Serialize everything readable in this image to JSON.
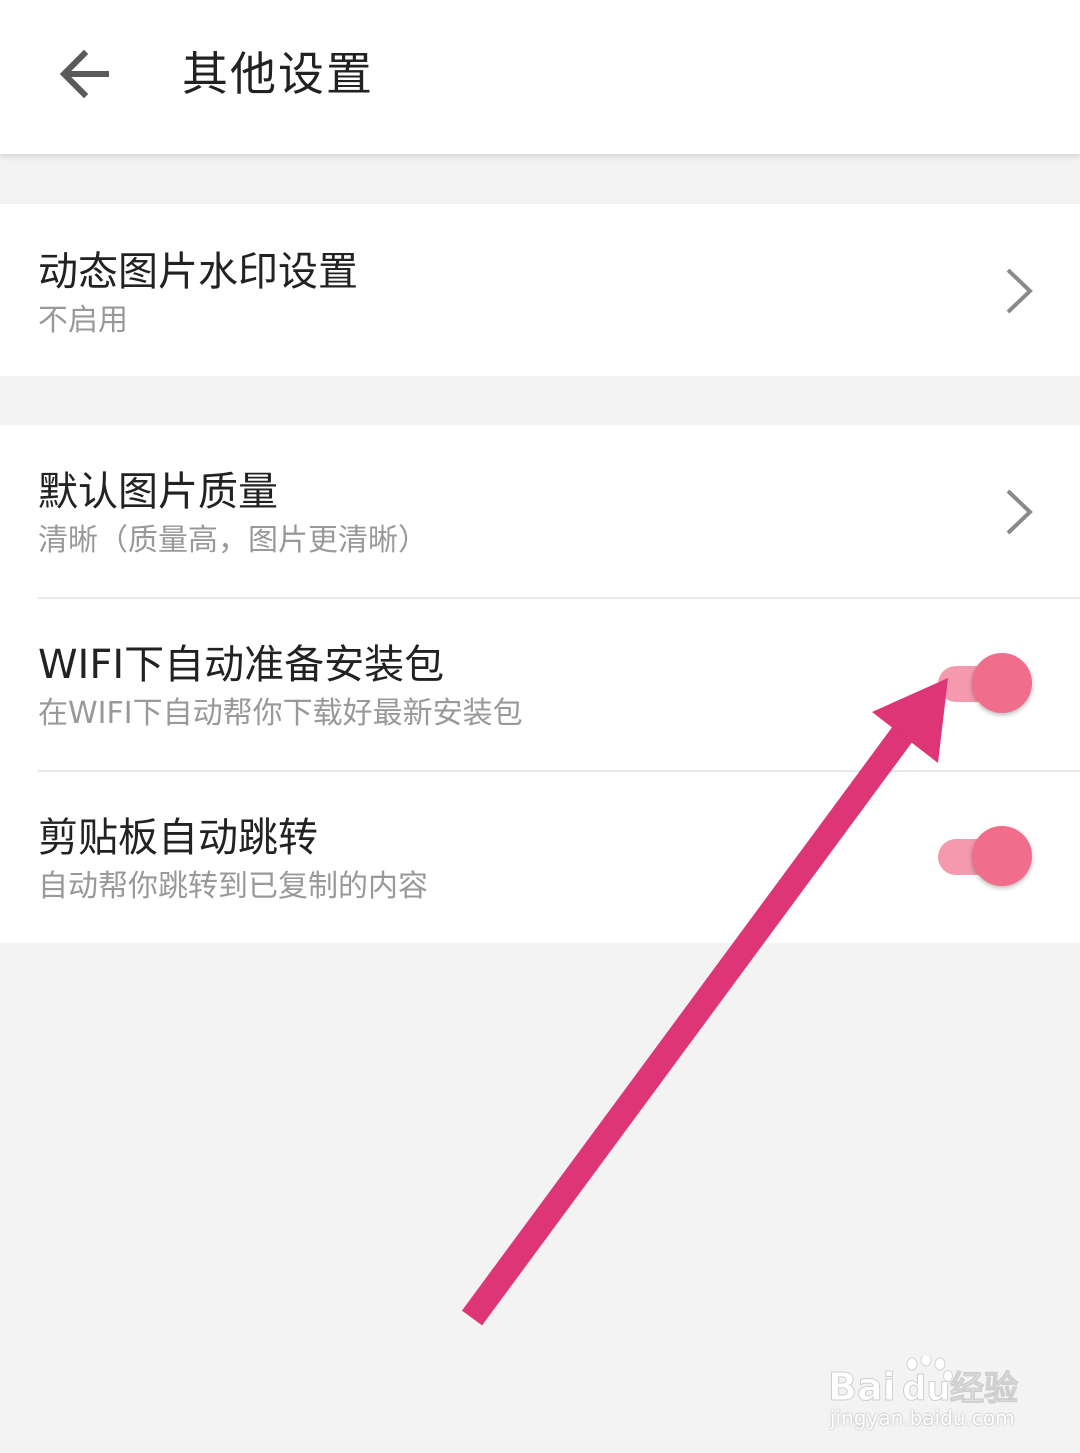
{
  "header": {
    "title": "其他设置",
    "back_icon": "arrow-left-icon"
  },
  "settings": [
    {
      "title": "动态图片水印设置",
      "subtitle": "不启用",
      "control": "chevron-right-icon"
    },
    {
      "title": "默认图片质量",
      "subtitle": "清晰（质量高，图片更清晰）",
      "control": "chevron-right-icon"
    },
    {
      "title": "WIFI下自动准备安装包",
      "subtitle": "在WIFI下自动帮你下载好最新安装包",
      "control": "toggle",
      "enabled": true
    },
    {
      "title": "剪贴板自动跳转",
      "subtitle": "自动帮你跳转到已复制的内容",
      "control": "toggle",
      "enabled": true
    }
  ],
  "annotation": {
    "type": "pointer-arrow",
    "color": "#de3577"
  },
  "watermark": {
    "logo_text": "Baidu经验",
    "url": "jingyan.baidu.com"
  },
  "colors": {
    "accent_knob": "#f06e8c",
    "accent_track": "#f59aae",
    "chevron": "#8a8a8a",
    "background": "#f3f3f3"
  }
}
